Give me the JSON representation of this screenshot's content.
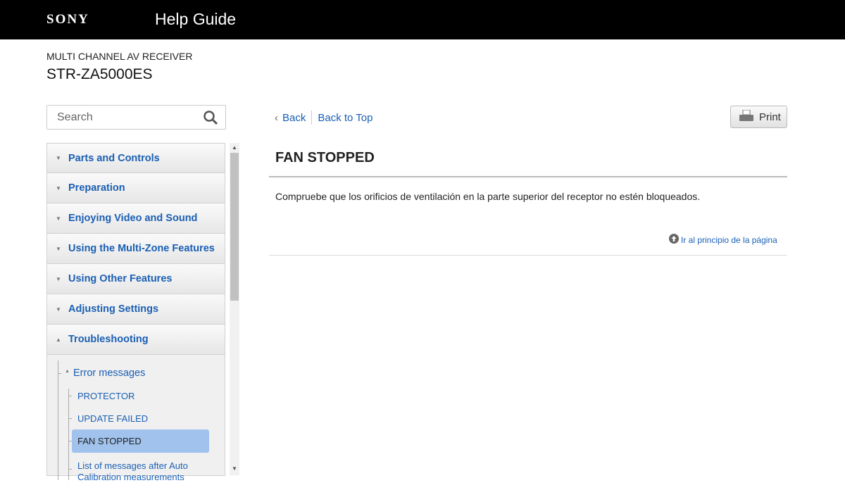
{
  "header": {
    "logo": "SONY",
    "title": "Help Guide"
  },
  "product": {
    "category": "MULTI CHANNEL AV RECEIVER",
    "model": "STR-ZA5000ES"
  },
  "search": {
    "placeholder": "Search"
  },
  "sidebar": {
    "items": [
      {
        "label": "Parts and Controls",
        "expanded": false
      },
      {
        "label": "Preparation",
        "expanded": false
      },
      {
        "label": "Enjoying Video and Sound",
        "expanded": false
      },
      {
        "label": "Using the Multi-Zone Features",
        "expanded": false
      },
      {
        "label": "Using Other Features",
        "expanded": false
      },
      {
        "label": "Adjusting Settings",
        "expanded": false
      },
      {
        "label": "Troubleshooting",
        "expanded": true
      }
    ],
    "sub": {
      "group": "Error messages",
      "items": [
        "PROTECTOR",
        "UPDATE FAILED",
        "FAN STOPPED",
        "List of messages after Auto Calibration measurements"
      ],
      "selected": "FAN STOPPED"
    }
  },
  "toolbar": {
    "back": "Back",
    "back_to_top": "Back to Top",
    "print": "Print"
  },
  "article": {
    "title": "FAN STOPPED",
    "body": "Compruebe que los orificios de ventilación en la parte superior del receptor no estén bloqueados.",
    "to_top": "Ir al principio de la página"
  },
  "colors": {
    "link": "#1a5fb4",
    "selected": "#a0c2ed",
    "header_bg": "#000000"
  }
}
